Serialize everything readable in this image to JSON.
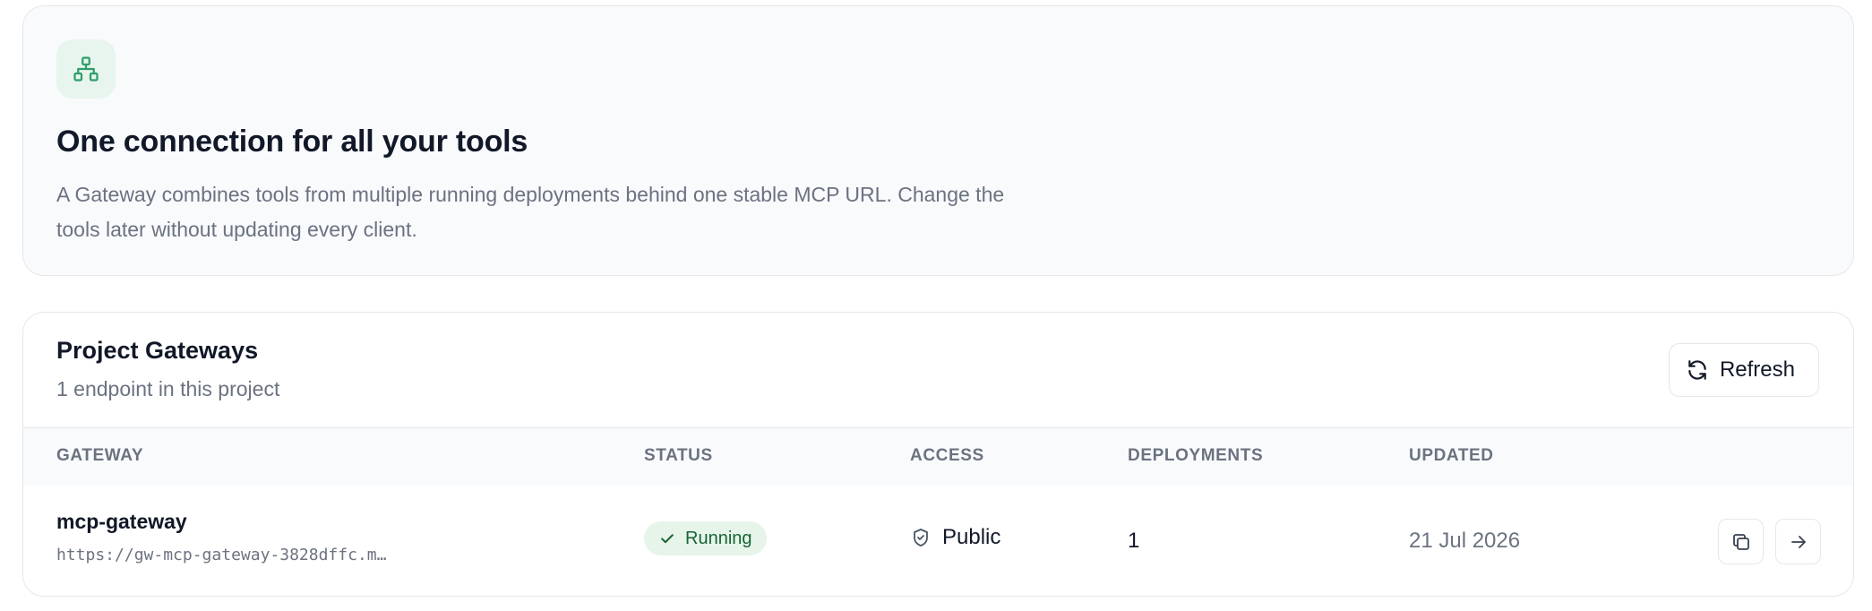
{
  "intro": {
    "icon": "network-icon",
    "title": "One connection for all your tools",
    "description": "A Gateway combines tools from multiple running deployments behind one stable MCP URL. Change the tools later without updating every client."
  },
  "gateways": {
    "title": "Project Gateways",
    "subtitle": "1 endpoint in this project",
    "refresh_label": "Refresh",
    "columns": {
      "gateway": "GATEWAY",
      "status": "STATUS",
      "access": "ACCESS",
      "deployments": "DEPLOYMENTS",
      "updated": "UPDATED"
    },
    "rows": [
      {
        "name": "mcp-gateway",
        "url": "https://gw-mcp-gateway-3828dffc.m…",
        "status": "Running",
        "access": "Public",
        "deployments": "1",
        "updated": "21 Jul 2026"
      }
    ]
  },
  "colors": {
    "accent_green": "#2f9e6a",
    "status_bg": "#e6f4ea",
    "status_text": "#166534",
    "muted_text": "#6b7280",
    "border": "#e5e7eb"
  }
}
